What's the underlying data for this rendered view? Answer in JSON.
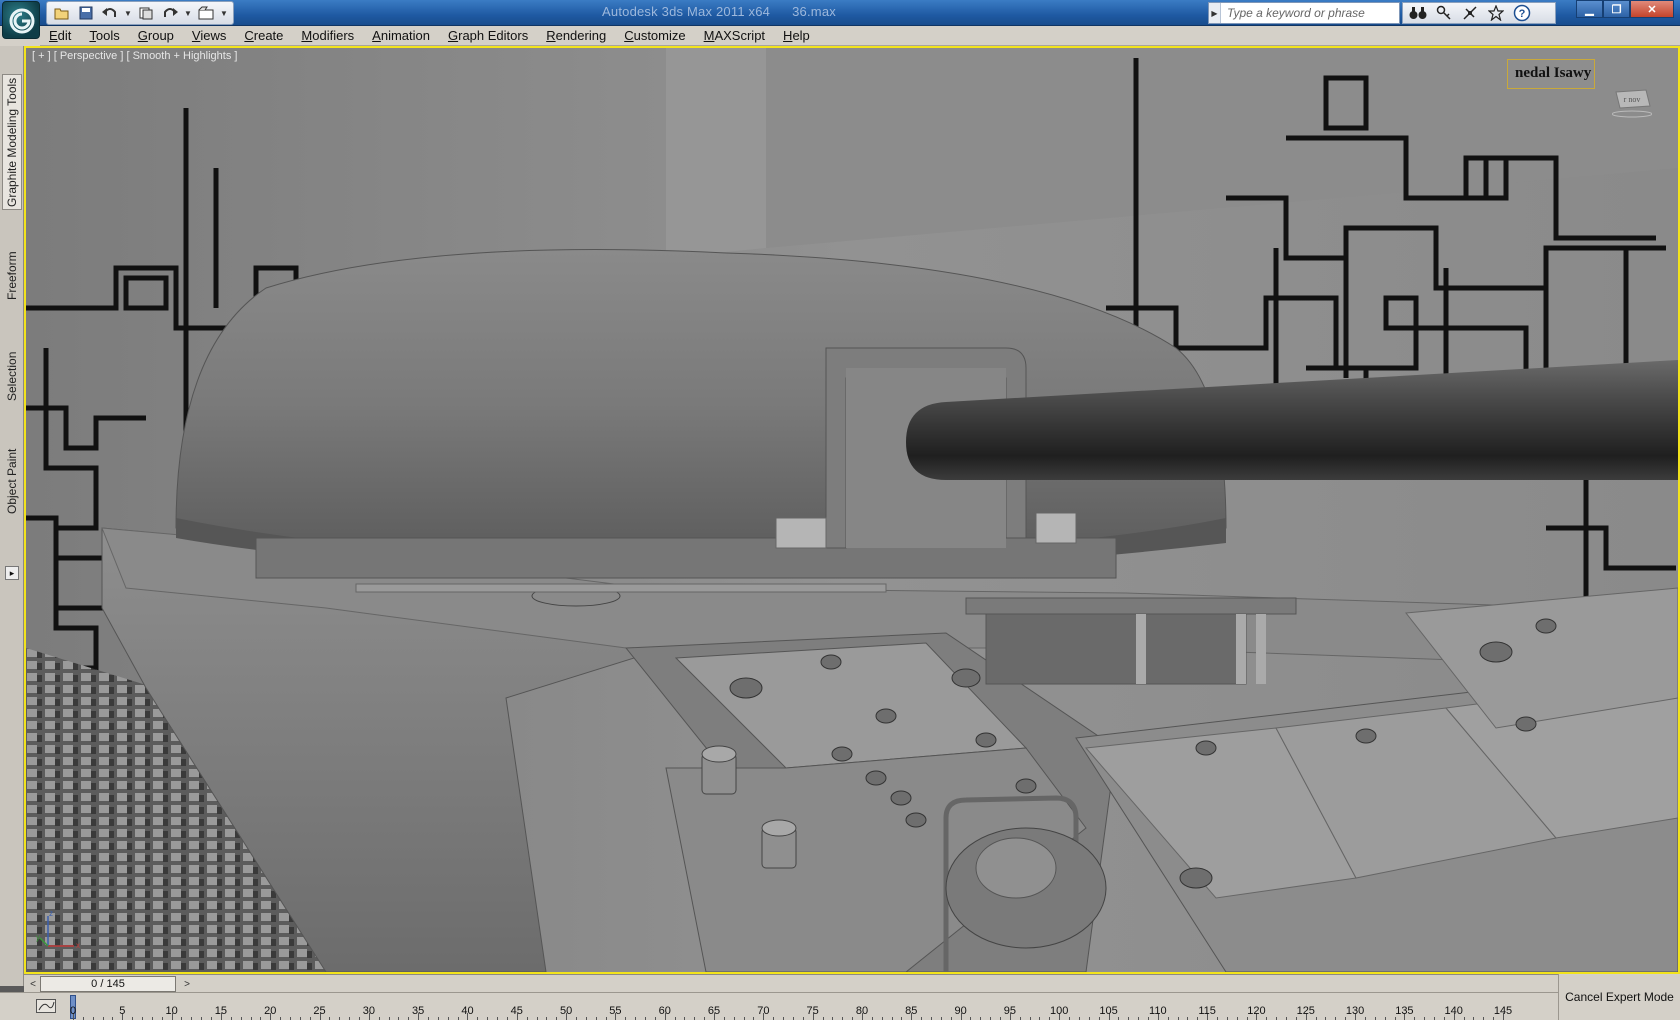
{
  "window": {
    "title_app": "Autodesk 3ds Max  2011 x64",
    "title_file": "36.max"
  },
  "quick_access": {
    "icons": [
      "open-icon",
      "save-icon",
      "undo-icon",
      "redo-icon",
      "project-folder-icon"
    ]
  },
  "infocenter": {
    "search_placeholder": "Type a keyword or phrase",
    "icons": [
      "binoculars-icon",
      "key-icon",
      "satellite-icon",
      "star-icon",
      "help-icon"
    ]
  },
  "menu": {
    "items": [
      "Edit",
      "Tools",
      "Group",
      "Views",
      "Create",
      "Modifiers",
      "Animation",
      "Graph Editors",
      "Rendering",
      "Customize",
      "MAXScript",
      "Help"
    ]
  },
  "ribbon_tabs": {
    "graphite": "Graphite Modeling Tools",
    "freeform": "Freeform",
    "selection": "Selection",
    "object_paint": "Object Paint"
  },
  "viewport": {
    "label": "[ + ] [ Perspective ] [ Smooth + Highlights ]",
    "name_tag": "nedal Isawy",
    "viewcube_label": "r nov"
  },
  "timeline": {
    "slider_text": "0 / 145",
    "prev_label": "<",
    "next_label": ">",
    "ruler_labels": [
      "0",
      "5",
      "10",
      "15",
      "20",
      "25",
      "30",
      "35",
      "40",
      "45",
      "50",
      "55",
      "60",
      "65",
      "70",
      "75",
      "80",
      "85",
      "90",
      "95",
      "100",
      "105",
      "110",
      "115",
      "120",
      "125",
      "130",
      "135",
      "140",
      "145"
    ]
  },
  "status": {
    "cancel_expert": "Cancel Expert Mode"
  },
  "colors": {
    "viewport_border": "#f2e31c",
    "titlebar": "#1f5aa3",
    "ui_gray": "#d4d0c8"
  }
}
